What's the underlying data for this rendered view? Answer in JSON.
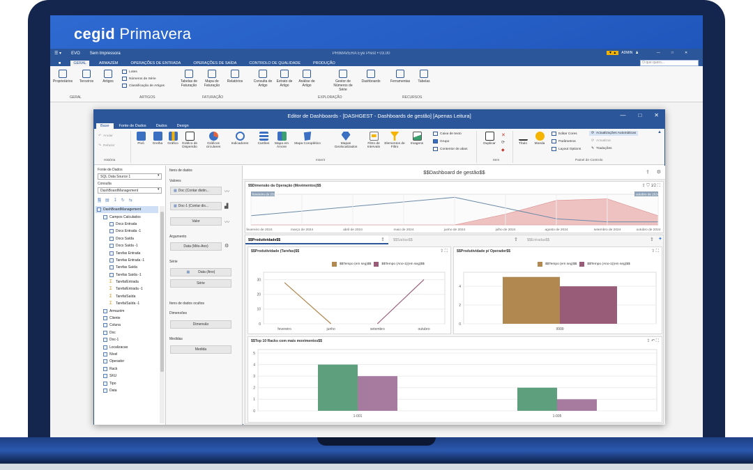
{
  "brand": {
    "name_bold": "cegid",
    "name_light": " Primavera"
  },
  "app": {
    "top": {
      "user_menu": "EVO",
      "printer": "Sem Impressora",
      "window_title": "PRIMAVERA Eye Prest • 03.00",
      "user": "ADMIN"
    },
    "tabs": [
      "GERAL",
      "ARMAZÉM",
      "OPERAÇÕES DE ENTRADA",
      "OPERAÇÕES DE SAÍDA",
      "CONTROLO DE QUALIDADE",
      "PRODUÇÃO"
    ],
    "search_placeholder": "O que quero...",
    "ribbon": {
      "buttons": [
        "Proprietários",
        "Terceiros",
        "Artigos",
        "Tabelas de Faturação",
        "Mapa de Faturação",
        "Relatórios",
        "Consulta de Artigo",
        "Extrato de Artigo",
        "Análise de Artigo",
        "Gestor de Números de Série",
        "Dashboards",
        "Ferramentas",
        "Tabelas"
      ],
      "small": [
        "Lotes",
        "Números de Série",
        "Classificação de Artigos"
      ],
      "groups": [
        "GERAL",
        "ARTIGOS",
        "FATURAÇÃO",
        "EXPLORAÇÃO",
        "RECURSOS"
      ]
    }
  },
  "dash": {
    "title": "Editor de Dashboards - [DASHGEST - Dashboards de gestão] [Apenas Leitura]",
    "tabs": [
      "Base",
      "Fonte de Dados",
      "Dados",
      "Design"
    ],
    "ribbon": {
      "history": {
        "undo": "Anular",
        "redo": "Refazer",
        "group": "História"
      },
      "buttons": [
        "Pivô",
        "Grelha",
        "Gráfico",
        "Gráfico de Dispersão",
        "Gráficos circulares",
        "Indicadores",
        "Cartões",
        "Mapa em Árvore",
        "Mapa Coroplético",
        "Mapas Geolocalizados",
        "Filtro de Intervalo",
        "Elementos de Filtro",
        "Imagens"
      ],
      "small_insert": [
        "Caixa de texto",
        "Grupo",
        "Contentor de abas"
      ],
      "insert_group": "Inserir",
      "item": {
        "duplicate": "Duplicar",
        "group": "Item"
      },
      "control": {
        "title": "Título",
        "currency": "Moeda",
        "edit_colors": "Editar Cores",
        "params": "Parâmetros",
        "layout": "Layout Options",
        "auto": "Actualizações Automáticas",
        "update": "Actualizar",
        "translations": "Traduções",
        "group": "Painel de Controlo"
      }
    },
    "panel1": {
      "source_label": "Fonte de Dados",
      "source_value": "SQL Data Source 1",
      "query_label": "Consulta",
      "query_value": "DashBoardManagement",
      "tree": [
        {
          "label": "DashBoardManagement",
          "indent": 0,
          "type": "root"
        },
        {
          "label": "Campos Calculados",
          "indent": 1,
          "type": "folder"
        },
        {
          "label": "Docs Entrada",
          "indent": 2,
          "type": "field"
        },
        {
          "label": "Docs Entrada -1",
          "indent": 2,
          "type": "field"
        },
        {
          "label": "Docs Saída",
          "indent": 2,
          "type": "field"
        },
        {
          "label": "Docs Saída -1",
          "indent": 2,
          "type": "field"
        },
        {
          "label": "Tarefas Entrada",
          "indent": 2,
          "type": "field"
        },
        {
          "label": "Tarefas Entrada -1",
          "indent": 2,
          "type": "field"
        },
        {
          "label": "Tarefas Saída",
          "indent": 2,
          "type": "field"
        },
        {
          "label": "Tarefas Saída -1",
          "indent": 2,
          "type": "field"
        },
        {
          "label": "Tarefa/Entrada",
          "indent": 2,
          "type": "sum"
        },
        {
          "label": "Tarefa/Entrada -1",
          "indent": 2,
          "type": "sum"
        },
        {
          "label": "Tarefa/Saída",
          "indent": 2,
          "type": "sum"
        },
        {
          "label": "Tarefa/Saída -1",
          "indent": 2,
          "type": "sum"
        },
        {
          "label": "Armazém",
          "indent": 1,
          "type": "field"
        },
        {
          "label": "Cliente",
          "indent": 1,
          "type": "field"
        },
        {
          "label": "Coluna",
          "indent": 1,
          "type": "field"
        },
        {
          "label": "Doc",
          "indent": 1,
          "type": "field"
        },
        {
          "label": "Doc-1",
          "indent": 1,
          "type": "field"
        },
        {
          "label": "Localizacao",
          "indent": 1,
          "type": "field"
        },
        {
          "label": "Nível",
          "indent": 1,
          "type": "field"
        },
        {
          "label": "Operador",
          "indent": 1,
          "type": "field"
        },
        {
          "label": "Rack",
          "indent": 1,
          "type": "field"
        },
        {
          "label": "SKU",
          "indent": 1,
          "type": "field"
        },
        {
          "label": "Tipo",
          "indent": 1,
          "type": "field"
        },
        {
          "label": "Data",
          "indent": 1,
          "type": "field"
        }
      ]
    },
    "panel2": {
      "items_label": "Itens de dados",
      "values_label": "Valores",
      "value1": "Doc (Contar distin...",
      "value2": "Doc-1 (Contar dis...",
      "value_add": "Valor",
      "argument_label": "Argumento",
      "argument": "Data (Mês-Ano)",
      "series_label": "Série",
      "series": "Data (Ano)",
      "series_add": "Série",
      "hidden_label": "Itens de dados ocultos",
      "dims_label": "Dimensões",
      "dims_add": "Dimensão",
      "measures_label": "Medidas",
      "measures_add": "Medida"
    },
    "main": {
      "header": "$$Dashboard de gestão$$",
      "range": {
        "title": "$$Dimensão da Operação (Movimentos)$$",
        "start_tag": "fevereiro de 2024",
        "end_tag": "outubro de 2024",
        "x_labels": [
          "fevereiro de 2024",
          "março de 2024",
          "abril de 2024",
          "maio de 2024",
          "junho de 2024",
          "julho de 2024",
          "agosto de 2024",
          "setembro de 2024",
          "outubro de 2024"
        ]
      },
      "tabs": [
        "$$Produtividade$$",
        "$$Saídas$$",
        "$$Entradas$$"
      ],
      "legend": [
        "$$Tempo (em seg)$$",
        "$$Tempo (Ano-1)(em seg)$$"
      ],
      "colors": {
        "s1_tan": "#b08850",
        "s2_plum": "#995c78",
        "s1_green": "#5ea07e",
        "s2_mauve": "#a77aa0"
      }
    }
  },
  "chart_data": [
    {
      "type": "area",
      "title": "$$Dimensão da Operação (Movimentos)$$",
      "categories": [
        "fevereiro de 2024",
        "março de 2024",
        "abril de 2024",
        "maio de 2024",
        "junho de 2024",
        "julho de 2024",
        "agosto de 2024",
        "setembro de 2024",
        "outubro de 2024"
      ],
      "series": [
        {
          "values": [
            0.3,
            0.45,
            0.6,
            0.75,
            0.9,
            0.55,
            0.2,
            0.1,
            0.1
          ]
        },
        {
          "values": [
            0,
            0,
            0,
            0,
            0,
            0.35,
            0.8,
            0.85,
            0.3
          ]
        }
      ]
    },
    {
      "type": "line",
      "title": "$$Produtividade (Tarefas)$$",
      "categories": [
        "fevereiro",
        "junho",
        "setembro",
        "outubro"
      ],
      "ylim": [
        0,
        35
      ],
      "yticks": [
        0,
        10,
        20,
        30
      ],
      "series": [
        {
          "name": "$$Tempo (em seg)$$",
          "values": [
            28,
            0,
            null,
            null
          ]
        },
        {
          "name": "$$Tempo (Ano-1)(em seg)$$",
          "values": [
            null,
            null,
            0,
            30
          ]
        }
      ]
    },
    {
      "type": "bar",
      "title": "$$Produtividade p/ Operador$$",
      "categories": [
        "9999"
      ],
      "ylim": [
        0,
        5.5
      ],
      "yticks": [
        0,
        2,
        4
      ],
      "series": [
        {
          "name": "$$Tempo (em seg)$$",
          "values": [
            5
          ]
        },
        {
          "name": "$$Tempo (Ano-1)(em seg)$$",
          "values": [
            4
          ]
        }
      ]
    },
    {
      "type": "bar",
      "title": "$$Top 10 Racks com mais movimentos$$",
      "categories": [
        "1-001",
        "1-005"
      ],
      "ylim": [
        0,
        5.3
      ],
      "yticks": [
        0,
        1,
        2,
        3,
        4,
        5
      ],
      "series": [
        {
          "values": [
            4,
            2
          ]
        },
        {
          "values": [
            3,
            1
          ]
        }
      ]
    }
  ]
}
